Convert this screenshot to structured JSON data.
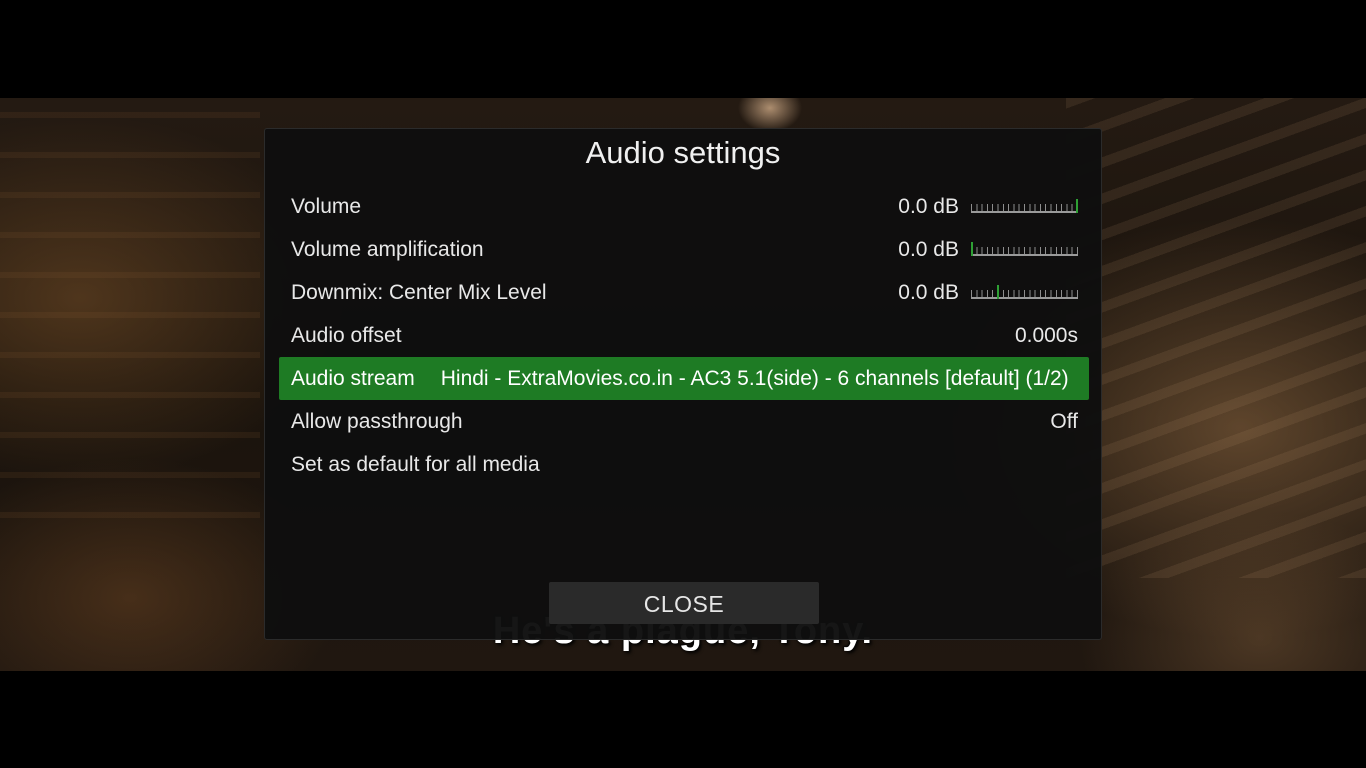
{
  "subtitle": "He's a plague, Tony.",
  "dialog": {
    "title": "Audio settings",
    "close_label": "CLOSE"
  },
  "settings": [
    {
      "label": "Volume",
      "value": "0.0 dB",
      "slider_position": 1.0
    },
    {
      "label": "Volume amplification",
      "value": "0.0 dB",
      "slider_position": 0.0
    },
    {
      "label": "Downmix: Center Mix Level",
      "value": "0.0 dB",
      "slider_position": 0.25
    },
    {
      "label": "Audio offset",
      "value": "0.000s"
    },
    {
      "label": "Audio stream",
      "value": "Hindi - ExtraMovies.co.in - AC3 5.1(side) - 6 channels [default] (1/2)",
      "selected": true
    },
    {
      "label": "Allow passthrough",
      "value": "Off"
    },
    {
      "label": "Set as default for all media"
    }
  ],
  "colors": {
    "selection": "#1e7b24",
    "slider_thumb": "#2ea034",
    "dialog_bg": "#0e0e0e"
  }
}
